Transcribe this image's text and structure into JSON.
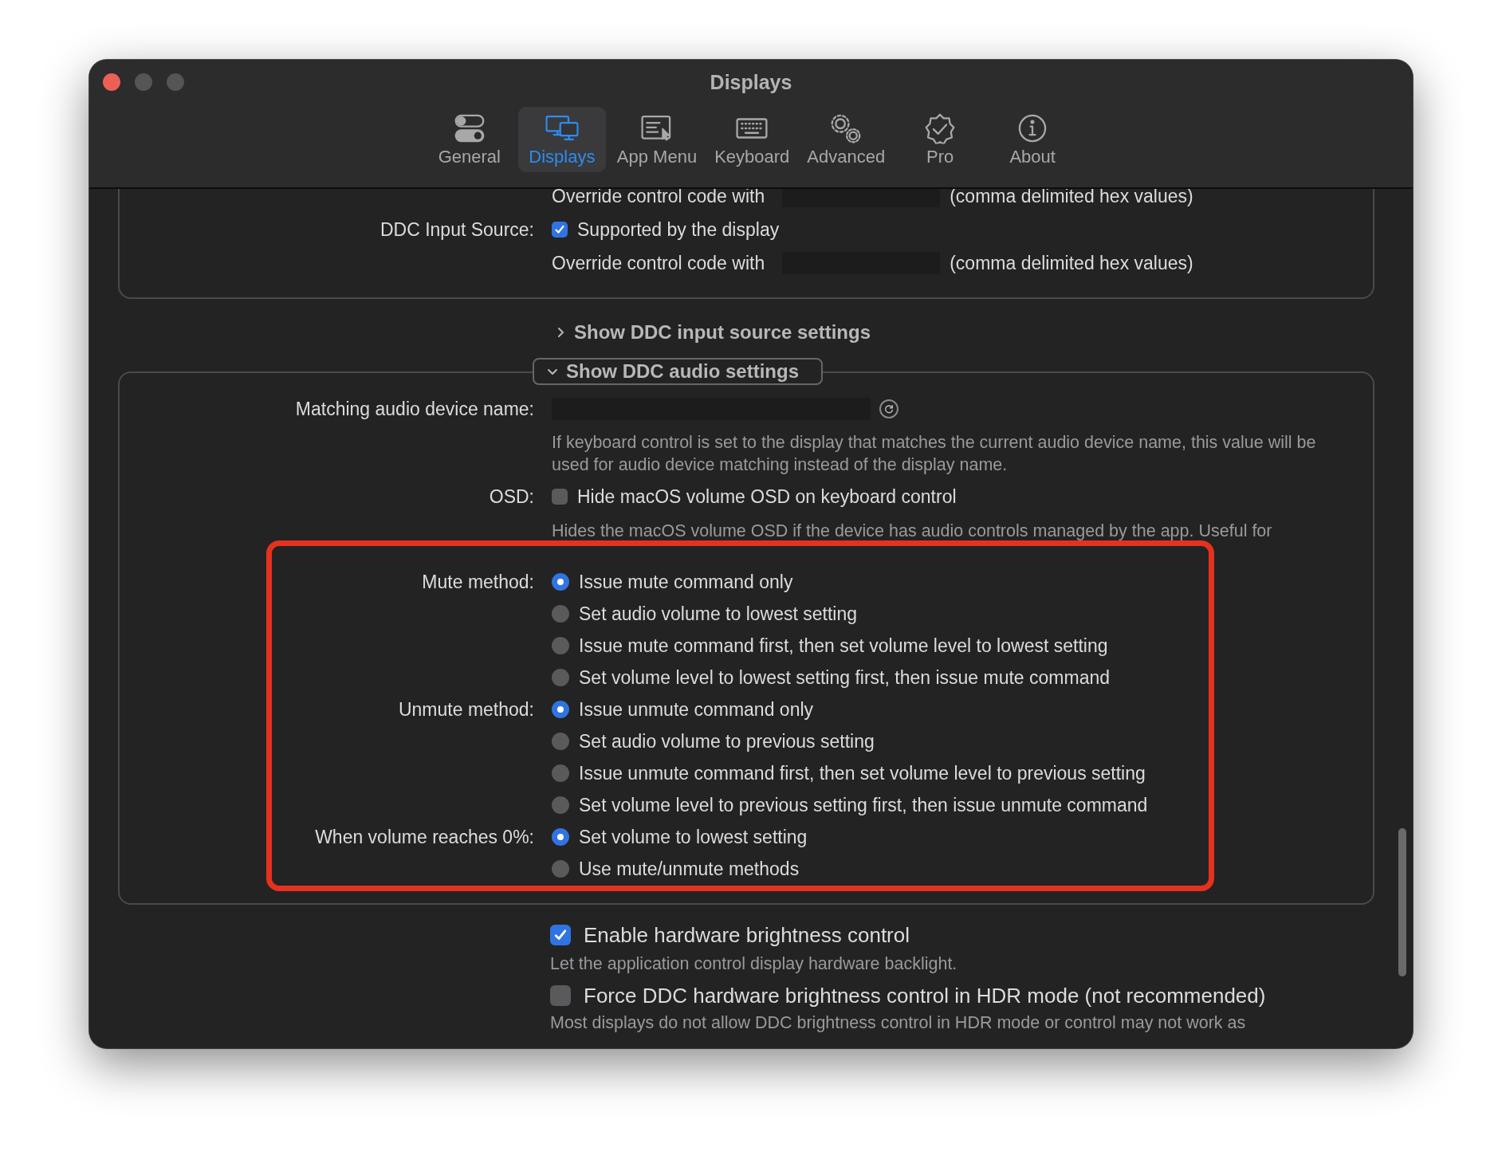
{
  "window": {
    "title": "Displays"
  },
  "tabs": [
    {
      "label": "General",
      "selected": false
    },
    {
      "label": "Displays",
      "selected": true
    },
    {
      "label": "App Menu",
      "selected": false
    },
    {
      "label": "Keyboard",
      "selected": false
    },
    {
      "label": "Advanced",
      "selected": false
    },
    {
      "label": "Pro",
      "selected": false
    },
    {
      "label": "About",
      "selected": false
    }
  ],
  "video_section": {
    "rows": [
      {
        "kind": "override",
        "text": "Override control code with",
        "suffix": "(comma delimited hex values)"
      },
      {
        "kind": "checkbox",
        "label": "DDC Input Source:",
        "text": "Supported by the display",
        "checked": true
      },
      {
        "kind": "override",
        "text": "Override control code with",
        "suffix": "(comma delimited hex values)"
      }
    ]
  },
  "input_source_disclosure": {
    "label": "Show DDC input source settings",
    "expanded": false
  },
  "audio_section": {
    "disclosure": {
      "label": "Show DDC audio settings",
      "expanded": true
    },
    "rows": [
      {
        "kind": "field",
        "label": "Matching audio device name:"
      },
      {
        "kind": "hint",
        "text": "If keyboard control is set to the display that matches the current audio device name, this value will be used for audio device matching instead of the display name."
      },
      {
        "kind": "checkbox",
        "label": "OSD:",
        "text": "Hide macOS volume OSD on keyboard control",
        "checked": false
      },
      {
        "kind": "hint",
        "text": "Hides the macOS volume OSD if the device has audio controls managed by the app. Useful for"
      },
      {
        "kind": "radio",
        "label": "Mute method:",
        "text": "Issue mute command only",
        "selected": true
      },
      {
        "kind": "radio",
        "text": "Set audio volume to lowest setting",
        "selected": false
      },
      {
        "kind": "radio",
        "text": "Issue mute command first, then set volume level to lowest setting",
        "selected": false
      },
      {
        "kind": "radio",
        "text": "Set volume level to lowest setting first, then issue mute command",
        "selected": false
      },
      {
        "kind": "radio",
        "label": "Unmute method:",
        "text": "Issue unmute command only",
        "selected": true
      },
      {
        "kind": "radio",
        "text": "Set audio volume to previous setting",
        "selected": false
      },
      {
        "kind": "radio",
        "text": "Issue unmute command first, then set volume level to previous setting",
        "selected": false
      },
      {
        "kind": "radio",
        "text": "Set volume level to previous setting first, then issue unmute command",
        "selected": false
      },
      {
        "kind": "radio",
        "label": "When volume reaches 0%:",
        "text": "Set volume to lowest setting",
        "selected": true
      },
      {
        "kind": "radio",
        "text": "Use mute/unmute methods",
        "selected": false
      }
    ]
  },
  "annotation": {
    "kind": "frame"
  },
  "brightness_rows": [
    {
      "kind": "bigcheck",
      "text": "Enable hardware brightness control",
      "checked": true
    },
    {
      "kind": "hint",
      "text": "Let the application control display hardware backlight."
    },
    {
      "kind": "bigcheck",
      "text": "Force DDC hardware brightness control in HDR mode (not recommended)",
      "checked": false
    },
    {
      "kind": "hint",
      "text": "Most displays do not allow DDC brightness control in HDR mode or control may not work as"
    }
  ]
}
